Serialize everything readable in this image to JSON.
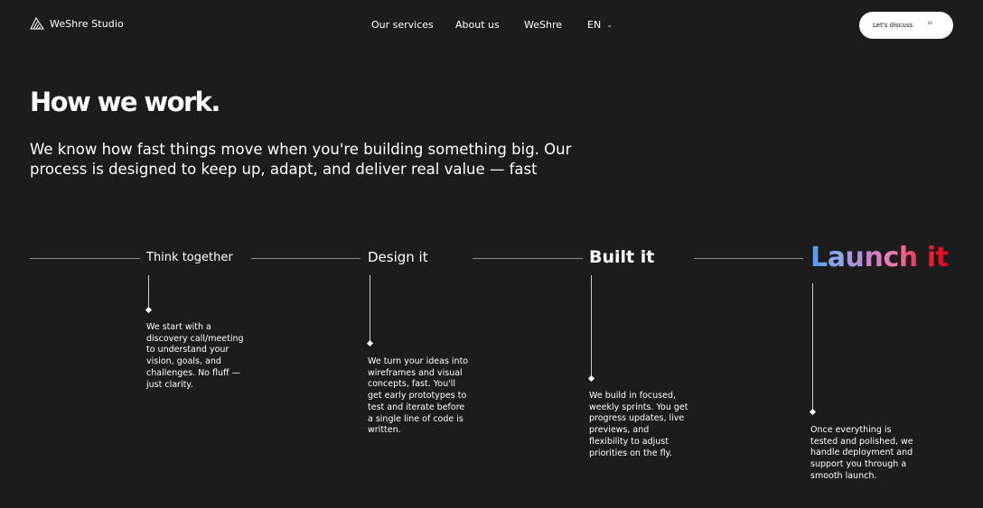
{
  "nav": {
    "brand": {
      "logo_icon": "weshre-logo-icon",
      "name": "WeShre Studio"
    },
    "links": [
      {
        "label": "Our services"
      },
      {
        "label": "About us"
      },
      {
        "label": "WeShre"
      }
    ],
    "language": {
      "label": "EN",
      "icon": "chevron-down-icon"
    },
    "cta": {
      "label": "Let's discuss",
      "icon": "double-chevron-right-icon"
    }
  },
  "hero": {
    "title": "How we work.",
    "intro": "We know how fast things move when you're building something big. Our process is designed to keep up, adapt, and deliver real value — fast"
  },
  "steps": [
    {
      "title": "Think together",
      "description": "We start with a discovery call/meeting to understand your vision, goals, and challenges. No fluff — just clarity."
    },
    {
      "title": "Design it",
      "description": "We turn your ideas into wireframes and visual concepts, fast. You'll get early prototypes to test and iterate before a single line of code is written."
    },
    {
      "title": "Built it",
      "description": "We build in focused, weekly sprints. You get progress updates, live previews, and flexibility to adjust priorities on the fly."
    },
    {
      "title": "Launch it",
      "description": "Once everything is tested and polished, we handle deployment and support you through a smooth launch."
    }
  ],
  "colors": {
    "background": "#1c1c1c",
    "text": "#ffffff",
    "cta_background": "#ffffff",
    "launch_gradient": [
      "#4f9af2",
      "#f07aa8",
      "#e60012"
    ]
  }
}
